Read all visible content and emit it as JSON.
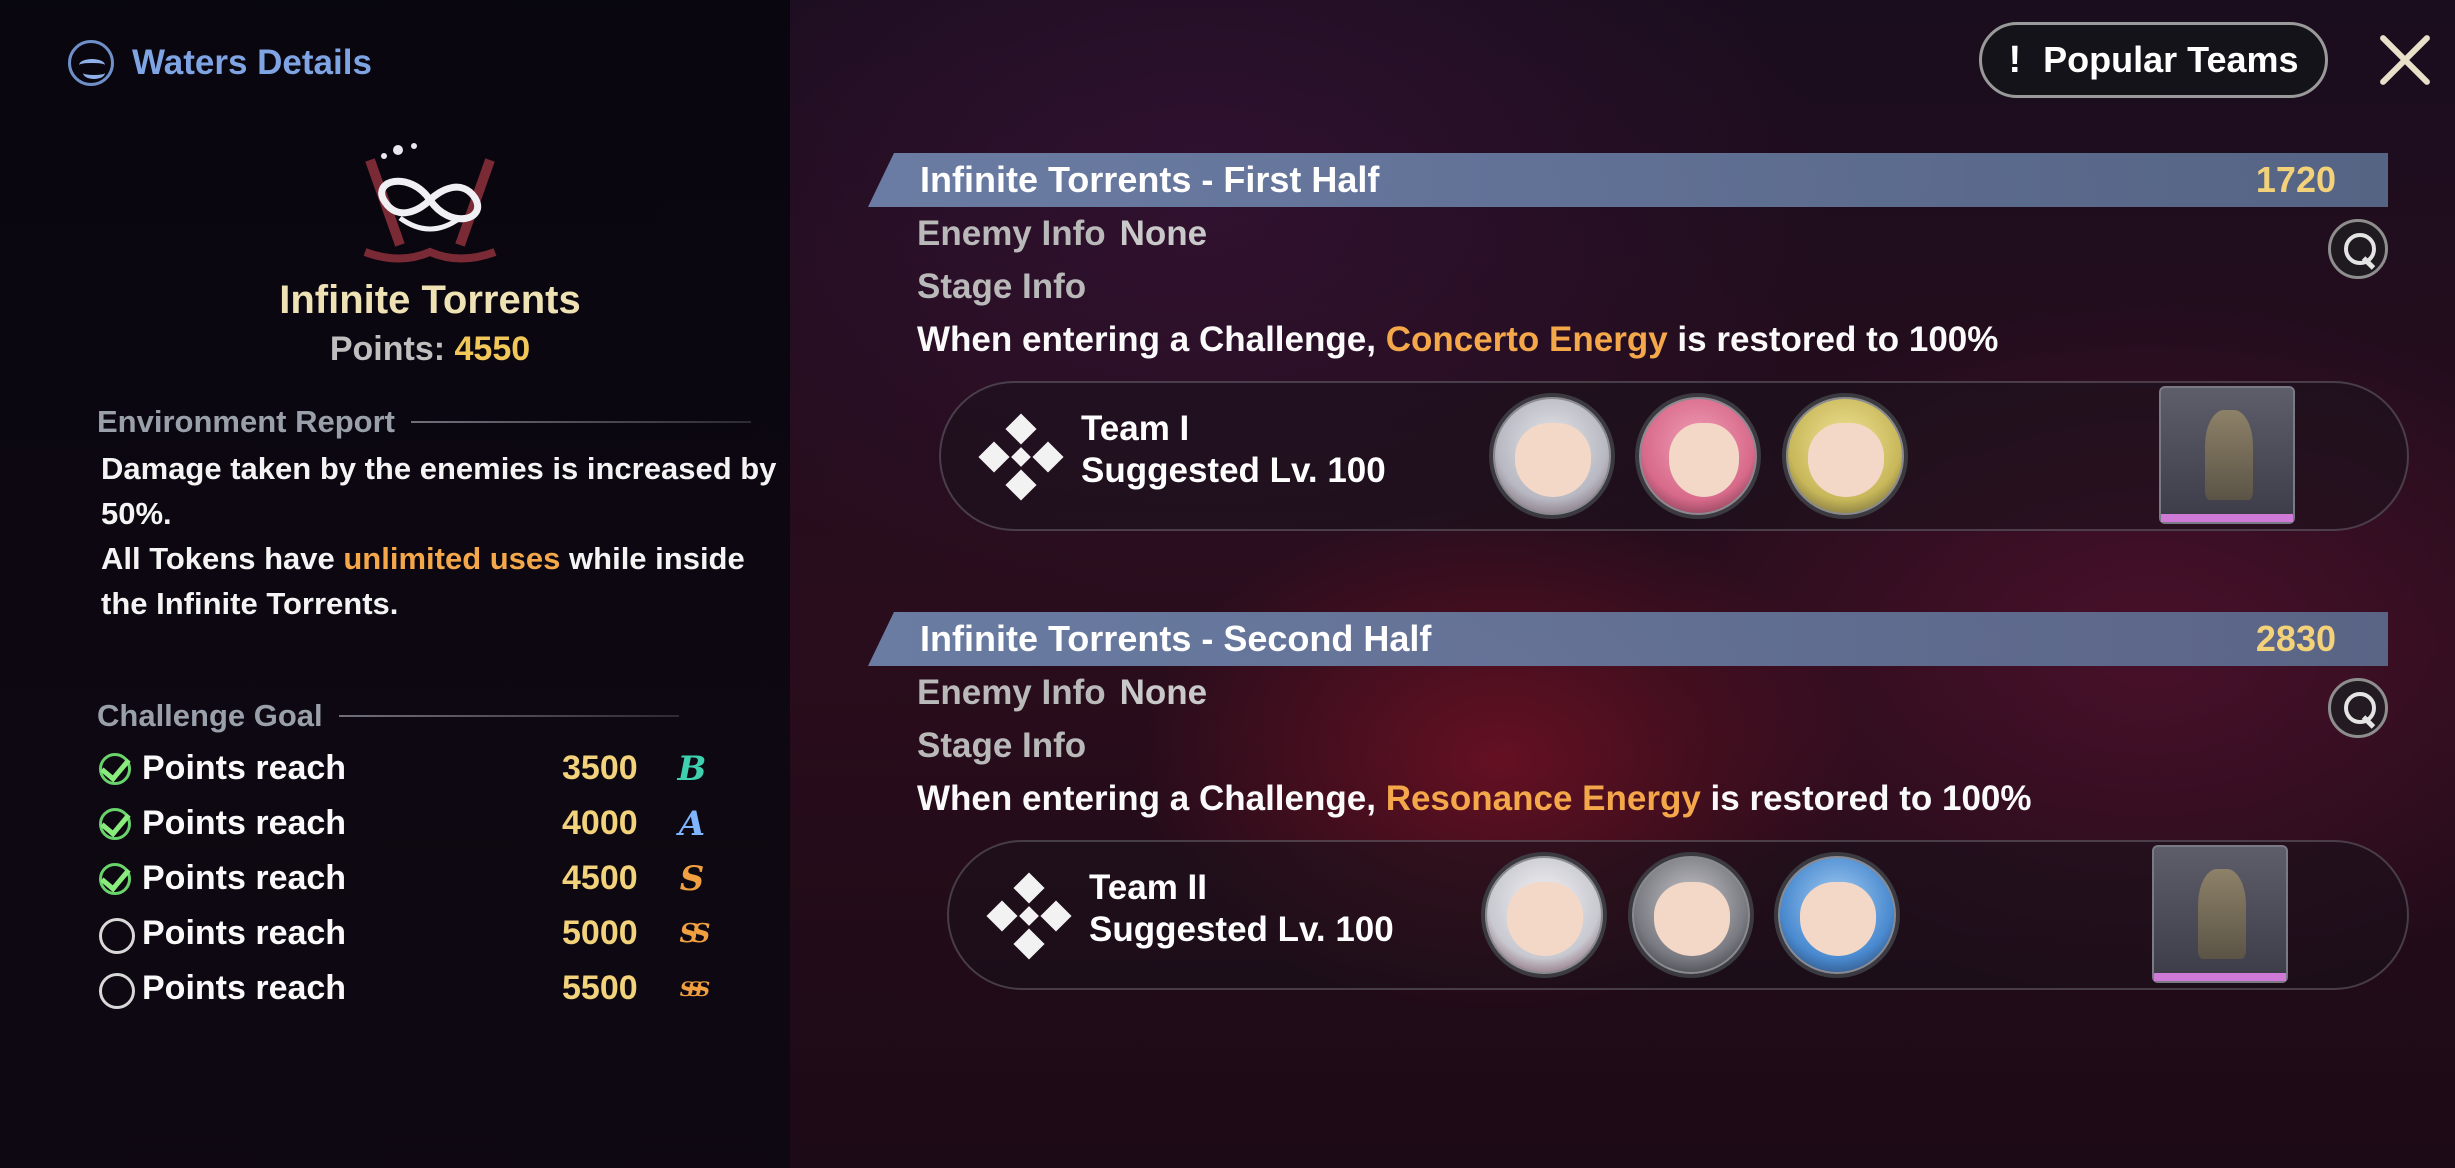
{
  "header": {
    "back_label": "Waters Details",
    "popular_button": "Popular Teams",
    "popular_icon": "!"
  },
  "left": {
    "mode_name": "Infinite Torrents",
    "points_label": "Points:",
    "points_value": "4550",
    "environment_heading": "Environment Report",
    "environment_lines": {
      "line1": "Damage taken by the enemies is increased by 50%.",
      "line2_pre": "All Tokens have",
      "line2_highlight": "unlimited uses",
      "line2_post": "while inside the Infinite Torrents."
    },
    "goal_heading": "Challenge Goal",
    "goals": [
      {
        "label": "Points reach",
        "value": "3500",
        "rank": "B",
        "done": true,
        "rank_color": "#3fd0b0"
      },
      {
        "label": "Points reach",
        "value": "4000",
        "rank": "A",
        "done": true,
        "rank_color": "#7fb4ff"
      },
      {
        "label": "Points reach",
        "value": "4500",
        "rank": "S",
        "done": true,
        "rank_color": "#f0a040"
      },
      {
        "label": "Points reach",
        "value": "5000",
        "rank": "SS",
        "done": false,
        "rank_color": "#f0a040"
      },
      {
        "label": "Points reach",
        "value": "5500",
        "rank": "SSS",
        "done": false,
        "rank_color": "#f0a040"
      }
    ]
  },
  "stages": [
    {
      "title": "Infinite Torrents - First Half",
      "score": "1720",
      "enemy_label": "Enemy Info",
      "enemy_value": "None",
      "stage_label": "Stage Info",
      "desc_pre": "When entering a Challenge,",
      "desc_highlight": "Concerto Energy",
      "desc_post": "is restored to 100%",
      "team_name": "Team I",
      "team_level": "Suggested Lv. 100"
    },
    {
      "title": "Infinite Torrents - Second Half",
      "score": "2830",
      "enemy_label": "Enemy Info",
      "enemy_value": "None",
      "stage_label": "Stage Info",
      "desc_pre": "When entering a Challenge,",
      "desc_highlight": "Resonance Energy",
      "desc_post": "is restored to 100%",
      "team_name": "Team II",
      "team_level": "Suggested Lv. 100"
    }
  ],
  "colors": {
    "accent_gold": "#f2c75a",
    "highlight_orange": "#f5a84a",
    "link_blue": "#7fa4e4",
    "check_green": "#67d36a"
  }
}
